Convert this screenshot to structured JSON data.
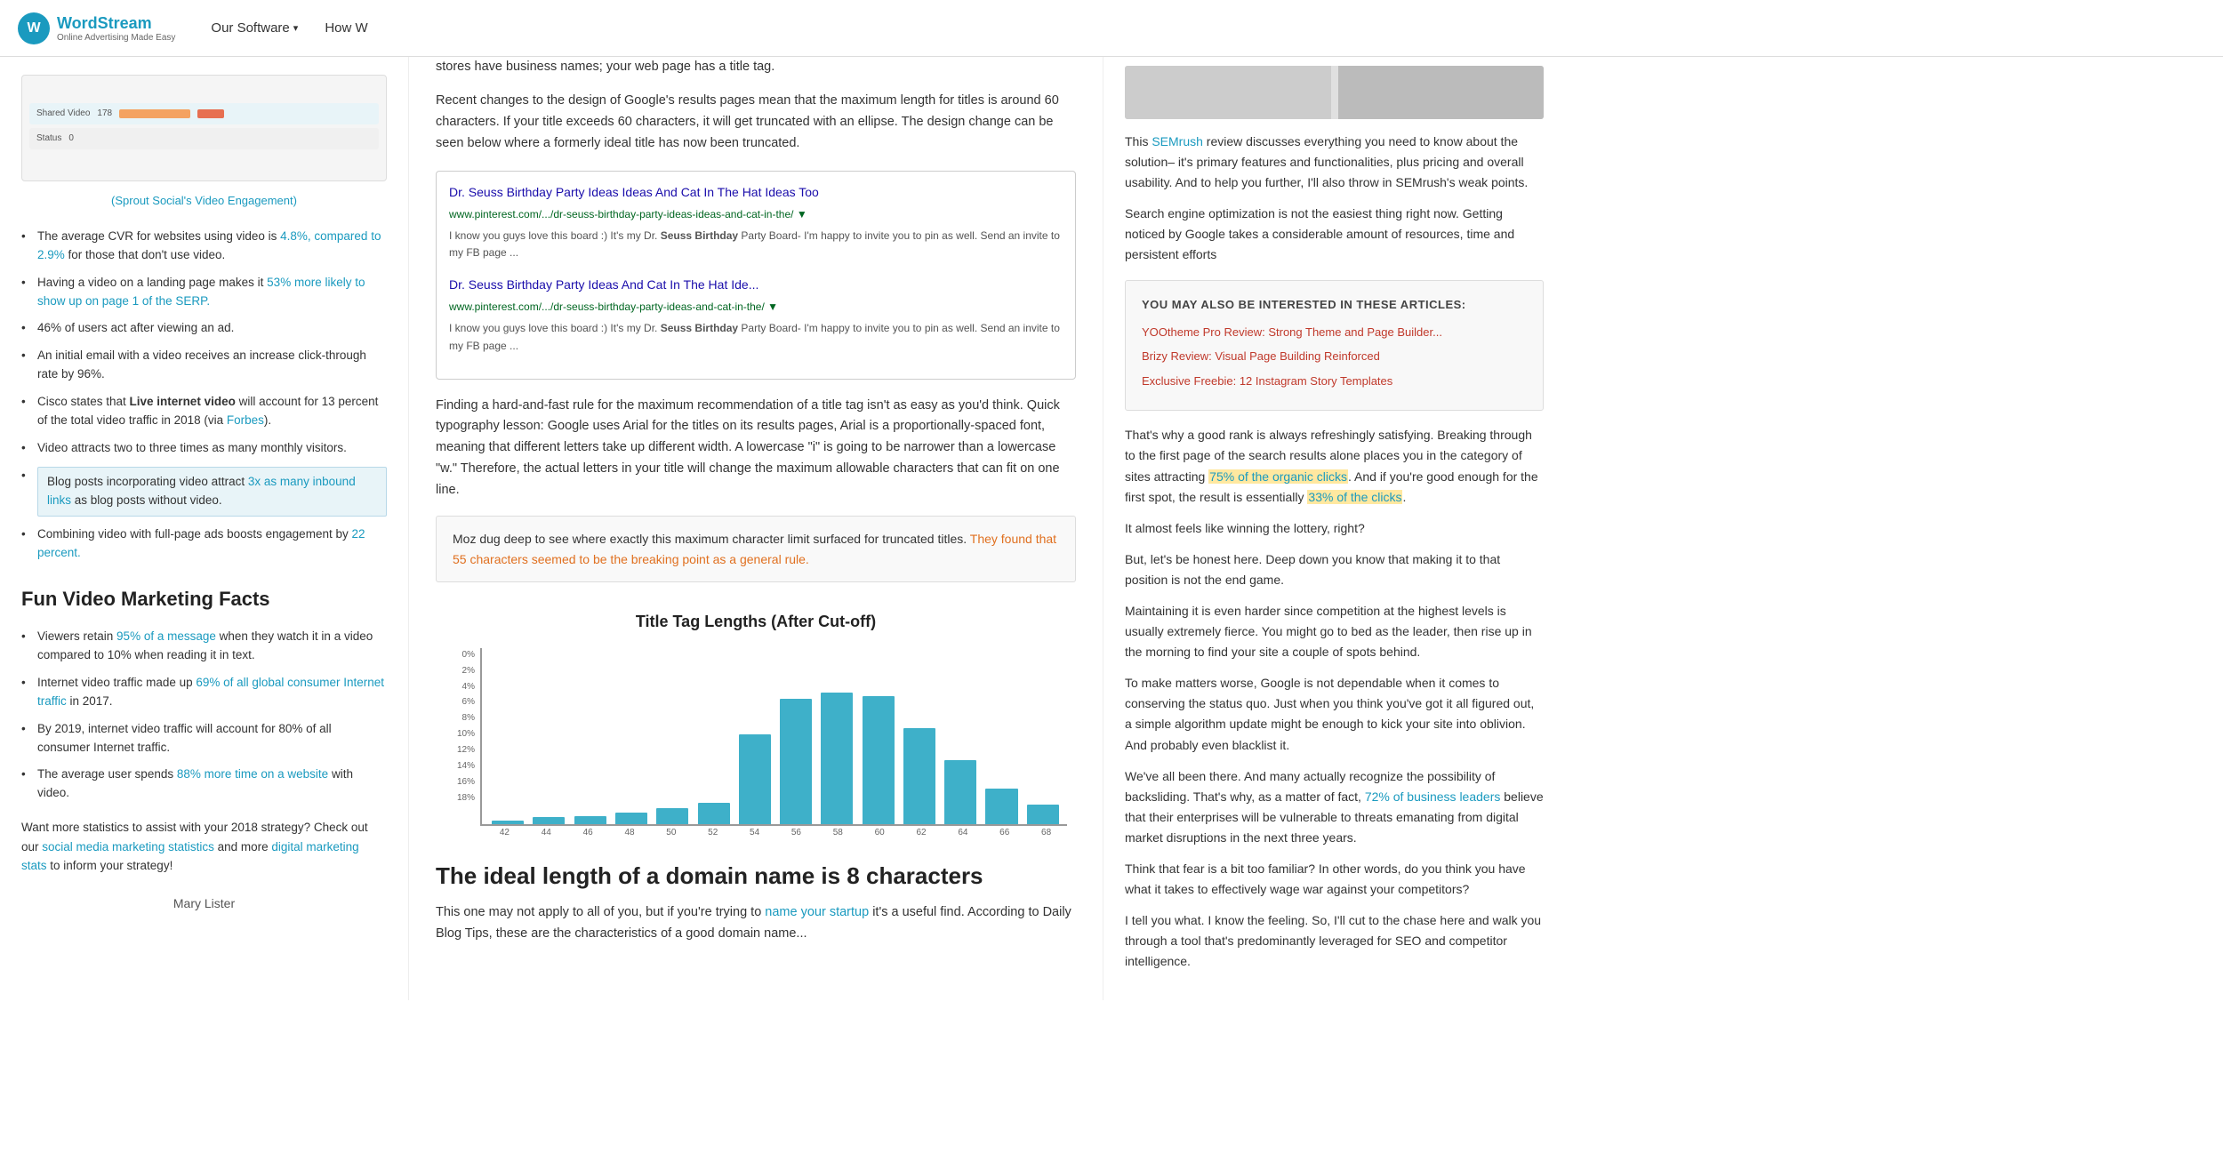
{
  "header": {
    "logo_title": "WordStream",
    "logo_subtitle": "Online Advertising Made Easy",
    "logo_icon": "W",
    "nav": [
      {
        "label": "Our Software",
        "has_dropdown": true
      },
      {
        "label": "How W",
        "has_dropdown": false
      }
    ]
  },
  "left_col": {
    "dashboard_alt": "Dashboard screenshot",
    "sprout_link_text": "(Sprout Social's Video Engagement)",
    "sprout_link_url": "#",
    "bullet_items": [
      {
        "text_before": "The average CVR for websites using video is ",
        "link1_text": "4.8%, compared to 2.9%",
        "text_after": " for those that don't use video."
      },
      {
        "text_before": "Having a video on a landing page makes it ",
        "link1_text": "53% more likely to show up on page 1 of the SERP.",
        "text_after": ""
      },
      {
        "text": "46% of users act after viewing an ad."
      },
      {
        "text": "An initial email with a video receives an increase click-through rate by 96%."
      },
      {
        "text_before": "Cisco states that ",
        "bold_text": "Live internet video",
        "text_after": " will account for 13 percent of the total video traffic in 2018 (via ",
        "link1_text": "Forbes",
        "text_end": ")."
      },
      {
        "text": "Video attracts two to three times as many monthly visitors."
      },
      {
        "is_highlight": true,
        "text_before": "Blog posts incorporating video attract ",
        "link1_text": "3x as many inbound links",
        "text_after": " as blog posts without video."
      },
      {
        "text_before": "Combining video with full-page ads boosts engagement by ",
        "link1_text": "22 percent.",
        "text_after": ""
      }
    ],
    "fun_facts_heading": "Fun Video Marketing Facts",
    "fun_facts": [
      {
        "text_before": "Viewers retain ",
        "link1_text": "95% of a message",
        "text_after": " when they watch it in a video compared to 10% when reading it in text."
      },
      {
        "text_before": "Internet video traffic made up ",
        "link1_text": "69% of all global consumer Internet traffic",
        "text_after": " in 2017."
      },
      {
        "text": "By 2019, internet video traffic will account for 80% of all consumer Internet traffic."
      },
      {
        "text_before": "The average user spends ",
        "link1_text": "88% more time on a website",
        "text_after": " with video."
      }
    ],
    "cta_text_before": "Want more statistics to assist with your 2018 strategy? Check out our ",
    "cta_link1": "social media marketing statistics",
    "cta_text_mid": " and more ",
    "cta_link2": "digital marketing stats",
    "cta_text_end": " to inform your strategy!",
    "author": "Mary Lister"
  },
  "mid_col": {
    "paragraphs": [
      "stores have business names; your web page has a title tag.",
      "Recent changes to the design of Google's results pages mean that the maximum length for titles is around 60 characters. If your title exceeds 60 characters, it will get truncated with an ellipse. The design change can be seen below where a formerly ideal title has now been truncated.",
      "Finding a hard-and-fast rule for the maximum recommendation of a title tag isn't as easy as you'd think. Quick typography lesson: Google uses Arial for the titles on its results pages, Arial is a proportionally-spaced font, meaning that different letters take up different width. A lowercase \"i\" is going to be narrower than a lowercase \"w.\" Therefore, the actual letters in your title will change the maximum allowable characters that can fit on one line."
    ],
    "search_results": [
      {
        "title": "Dr. Seuss Birthday Party Ideas Ideas And Cat In The Hat Ideas Too",
        "url": "www.pinterest.com/.../dr-seuss-birthday-party-ideas-ideas-and-cat-in-the/ ▼",
        "desc_before": "I know you guys love this board :) It's my Dr. ",
        "desc_bold": "Seuss Birthday",
        "desc_after": " Party Board- I'm happy to invite you to pin as well. Send an invite to my FB page ..."
      },
      {
        "title": "Dr. Seuss Birthday Party Ideas And Cat In The Hat Ide...",
        "url": "www.pinterest.com/.../dr-seuss-birthday-party-ideas-and-cat-in-the/ ▼",
        "desc_before": "I know you guys love this board :) It's my Dr. ",
        "desc_bold": "Seuss Birthday",
        "desc_after": " Party Board- I'm happy to invite you to pin as well. Send an invite to my FB page ..."
      }
    ],
    "callout_text_before": "Moz dug deep to see where exactly this maximum character limit surfaced for truncated titles. ",
    "callout_link_text": "They found that 55 characters seemed to be the breaking point as a general rule.",
    "callout_link_url": "#",
    "chart_title": "Title Tag Lengths (After Cut-off)",
    "chart_y_labels": [
      "18%",
      "16%",
      "14%",
      "12%",
      "10%",
      "8%",
      "6%",
      "4%",
      "2%",
      "0%"
    ],
    "chart_bars": [
      {
        "label": "42",
        "height_pct": 2
      },
      {
        "label": "44",
        "height_pct": 4
      },
      {
        "label": "46",
        "height_pct": 5
      },
      {
        "label": "48",
        "height_pct": 7
      },
      {
        "label": "50",
        "height_pct": 10
      },
      {
        "label": "52",
        "height_pct": 13
      },
      {
        "label": "54",
        "height_pct": 56
      },
      {
        "label": "56",
        "height_pct": 78
      },
      {
        "label": "58",
        "height_pct": 82
      },
      {
        "label": "60",
        "height_pct": 80
      },
      {
        "label": "62",
        "height_pct": 60
      },
      {
        "label": "64",
        "height_pct": 40
      },
      {
        "label": "66",
        "height_pct": 22
      },
      {
        "label": "68",
        "height_pct": 12
      }
    ],
    "section_heading": "The ideal length of a domain name is 8 characters",
    "section_para": "This one may not apply to all of you, but if you're trying to "
  },
  "right_col": {
    "paragraphs": [
      {
        "text_before": "This ",
        "link_text": "SEMrush",
        "text_after": " review discusses everything you need to know about the solution– it's primary features and functionalities, plus pricing and overall usability. And to help you further, I'll also throw in SEMrush's weak points."
      },
      {
        "text": "Search engine optimization is not the easiest thing right now. Getting noticed by Google takes a considerable amount of resources, time and persistent efforts"
      }
    ],
    "articles_box": {
      "title": "YOU MAY ALSO BE INTERESTED IN THESE ARTICLES:",
      "links": [
        "YOOtheme Pro Review: Strong Theme and Page Builder...",
        "Brizy Review: Visual Page Building Reinforced",
        "Exclusive Freebie: 12 Instagram Story Templates"
      ]
    },
    "body_paragraphs": [
      {
        "text_before": "That's why a good rank is always refreshingly satisfying. Breaking through to the first page of the search results alone places you in the category of sites attracting ",
        "link1_text": "75% of the organic clicks",
        "text_mid": ". And if you're good enough for the first spot, the result is essentially ",
        "link2_text": "33% of the clicks",
        "text_end": ".",
        "highlight": true
      },
      {
        "text": "It almost feels like winning the lottery, right?"
      },
      {
        "text": "But, let's be honest here. Deep down you know that making it to that position is not the end game."
      },
      {
        "text": "Maintaining it is even harder since competition at the highest levels is usually extremely fierce. You might go to bed as the leader, then rise up in the morning to find your site a couple of spots behind."
      },
      {
        "text": "To make matters worse, Google is not dependable when it comes to conserving the status quo. Just when you think you've got it all figured out, a simple algorithm update might be enough to kick your site into oblivion. And probably even blacklist it."
      },
      {
        "text_before": "We've all been there. And many actually recognize the possibility of backsliding. That's why, as a matter of fact, ",
        "link1_text": "72% of business leaders",
        "text_after": " believe that their enterprises will be vulnerable to threats emanating from digital market disruptions in the next three years."
      },
      {
        "text": "Think that fear is a bit too familiar? In other words, do you think you have what it takes to effectively wage war against your competitors?"
      },
      {
        "text": "I tell you what. I know the feeling. So, I'll cut to the chase here and walk you through a tool that's predominantly leveraged for SEO and competitor intelligence."
      }
    ]
  }
}
